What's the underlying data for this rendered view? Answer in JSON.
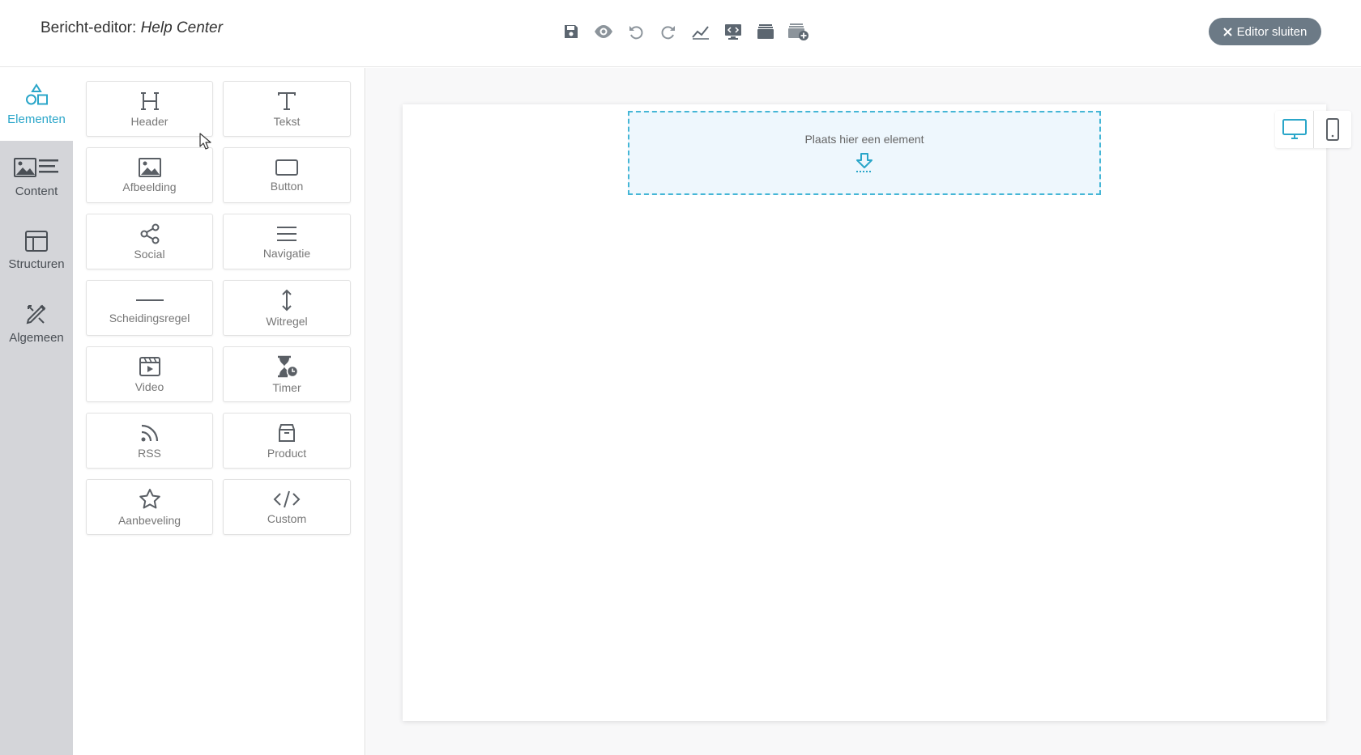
{
  "header": {
    "title_prefix": "Bericht-editor:",
    "title_doc": "Help Center",
    "close_label": "Editor sluiten",
    "close_icon": "x-icon",
    "tools": [
      {
        "name": "save-icon"
      },
      {
        "name": "preview-icon"
      },
      {
        "name": "undo-icon"
      },
      {
        "name": "redo-icon"
      },
      {
        "name": "stats-icon"
      },
      {
        "name": "code-view-icon"
      },
      {
        "name": "template-icon"
      },
      {
        "name": "add-template-icon"
      }
    ]
  },
  "sidebar": {
    "items": [
      {
        "label": "Elementen",
        "icon": "shapes-icon",
        "active": true
      },
      {
        "label": "Content",
        "icon": "image-text-icon",
        "active": false
      },
      {
        "label": "Structuren",
        "icon": "layout-icon",
        "active": false
      },
      {
        "label": "Algemeen",
        "icon": "brush-icon",
        "active": false
      }
    ]
  },
  "elements": [
    {
      "label": "Header",
      "icon": "heading-icon"
    },
    {
      "label": "Tekst",
      "icon": "text-icon"
    },
    {
      "label": "Afbeelding",
      "icon": "image-icon"
    },
    {
      "label": "Button",
      "icon": "button-icon"
    },
    {
      "label": "Social",
      "icon": "share-icon"
    },
    {
      "label": "Navigatie",
      "icon": "menu-icon"
    },
    {
      "label": "Scheidingsregel",
      "icon": "divider-icon"
    },
    {
      "label": "Witregel",
      "icon": "spacer-icon"
    },
    {
      "label": "Video",
      "icon": "video-icon"
    },
    {
      "label": "Timer",
      "icon": "hourglass-icon"
    },
    {
      "label": "RSS",
      "icon": "rss-icon"
    },
    {
      "label": "Product",
      "icon": "box-icon"
    },
    {
      "label": "Aanbeveling",
      "icon": "star-icon"
    },
    {
      "label": "Custom",
      "icon": "code-icon"
    }
  ],
  "canvas": {
    "dropzone_text": "Plaats hier een element",
    "dropzone_icon": "drop-arrow-icon",
    "device_desktop_icon": "desktop-icon",
    "device_mobile_icon": "mobile-icon",
    "active_device": "desktop"
  },
  "colors": {
    "accent": "#2aa6c9",
    "dropzone_border": "#45b6d6",
    "close_button": "#6c7a86",
    "sidebar_bg": "#d4d5d9"
  }
}
